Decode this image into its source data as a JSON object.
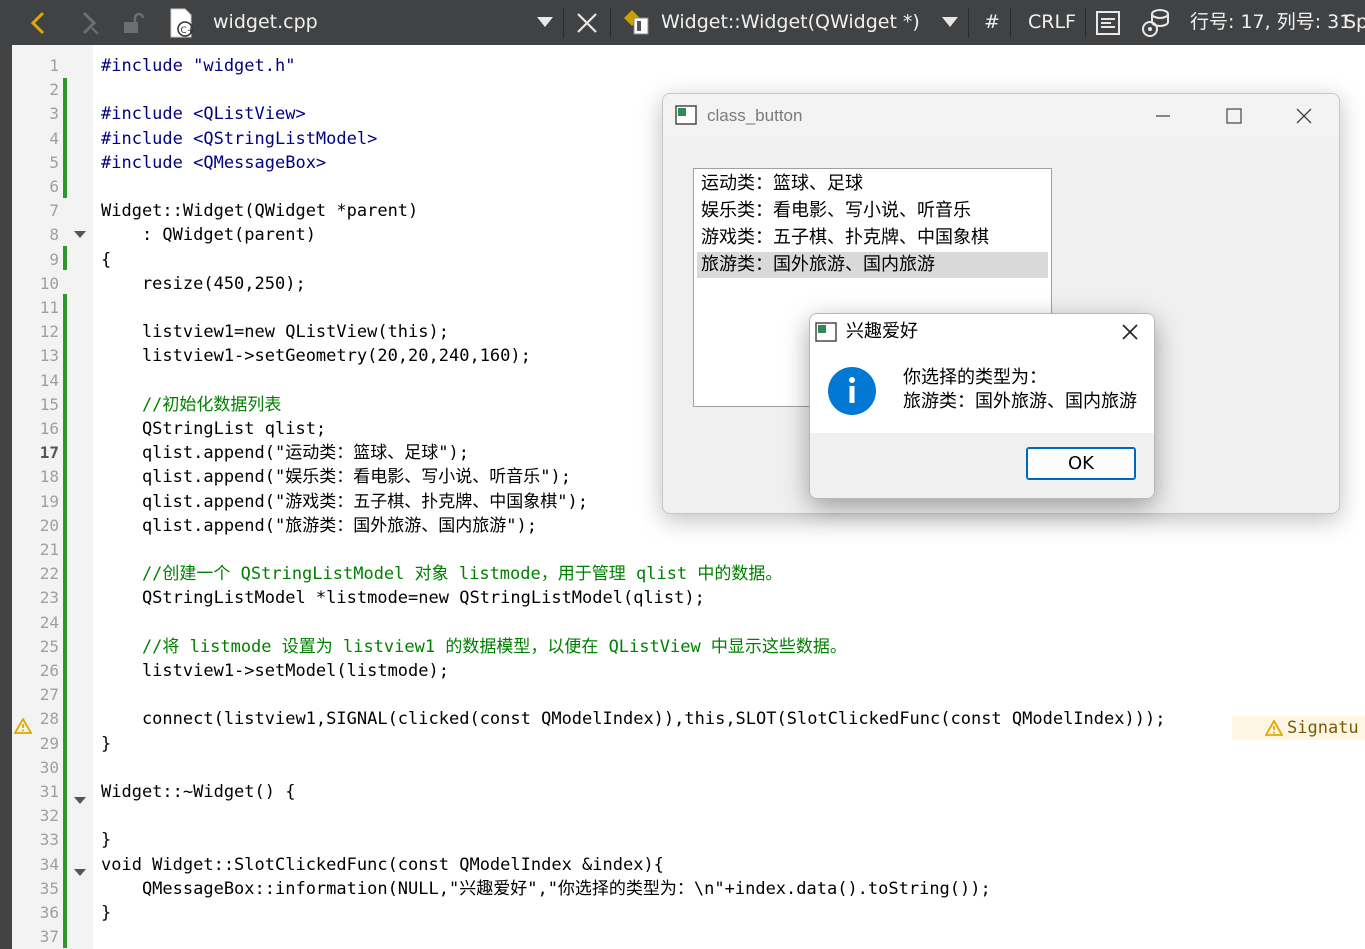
{
  "toolbar": {
    "file_name": "widget.cpp",
    "function_name": "Widget::Widget(QWidget *)",
    "hash": "#",
    "line_ending": "CRLF",
    "position": "行号: 17, 列号: 31",
    "trailing": "Sp"
  },
  "editor": {
    "current_line": 17,
    "line_numbers": [
      "1",
      "2",
      "3",
      "4",
      "5",
      "6",
      "7",
      "8",
      "9",
      "10",
      "11",
      "12",
      "13",
      "14",
      "15",
      "16",
      "17",
      "18",
      "19",
      "20",
      "21",
      "22",
      "23",
      "24",
      "25",
      "26",
      "27",
      "28",
      "29",
      "30",
      "31",
      "32",
      "33",
      "34",
      "35",
      "36",
      "37"
    ],
    "lines": [
      "#include \"widget.h\"",
      "",
      "#include <QListView>",
      "#include <QStringListModel>",
      "#include <QMessageBox>",
      "",
      "Widget::Widget(QWidget *parent)",
      "    : QWidget(parent)",
      "{",
      "    resize(450,250);",
      "",
      "    listview1=new QListView(this);",
      "    listview1->setGeometry(20,20,240,160);",
      "",
      "    //初始化数据列表",
      "    QStringList qlist;",
      "    qlist.append(\"运动类：篮球、足球\");",
      "    qlist.append(\"娱乐类：看电影、写小说、听音乐\");",
      "    qlist.append(\"游戏类：五子棋、扑克牌、中国象棋\");",
      "    qlist.append(\"旅游类：国外旅游、国内旅游\");",
      "",
      "    //创建一个 QStringListModel 对象 listmode，用于管理 qlist 中的数据。",
      "    QStringListModel *listmode=new QStringListModel(qlist);",
      "",
      "    //将 listmode 设置为 listview1 的数据模型，以便在 QListView 中显示这些数据。",
      "    listview1->setModel(listmode);",
      "",
      "    connect(listview1,SIGNAL(clicked(const QModelIndex)),this,SLOT(SlotClickedFunc(const QModelIndex)));",
      "}",
      "",
      "Widget::~Widget() {",
      "",
      "}",
      "void Widget::SlotClickedFunc(const QModelIndex &index){",
      "    QMessageBox::information(NULL,\"兴趣爱好\",\"你选择的类型为：\\n\"+index.data().toString());",
      "}",
      ""
    ],
    "warning_text": "Signatu"
  },
  "app_window": {
    "title": "class_button",
    "list_items": [
      "运动类：篮球、足球",
      "娱乐类：看电影、写小说、听音乐",
      "游戏类：五子棋、扑克牌、中国象棋",
      "旅游类：国外旅游、国内旅游"
    ],
    "selected_index": 3
  },
  "message_box": {
    "title": "兴趣爱好",
    "line1": "你选择的类型为：",
    "line2": "旅游类：国外旅游、国内旅游",
    "ok_label": "OK",
    "icon": "information-icon"
  },
  "colors": {
    "toolbar_bg": "#404244",
    "change_marker": "#2b9a2b",
    "keyword": "#808000",
    "class": "#800080",
    "function": "#00677c",
    "string": "#008000",
    "info_icon": "#0078d4"
  }
}
